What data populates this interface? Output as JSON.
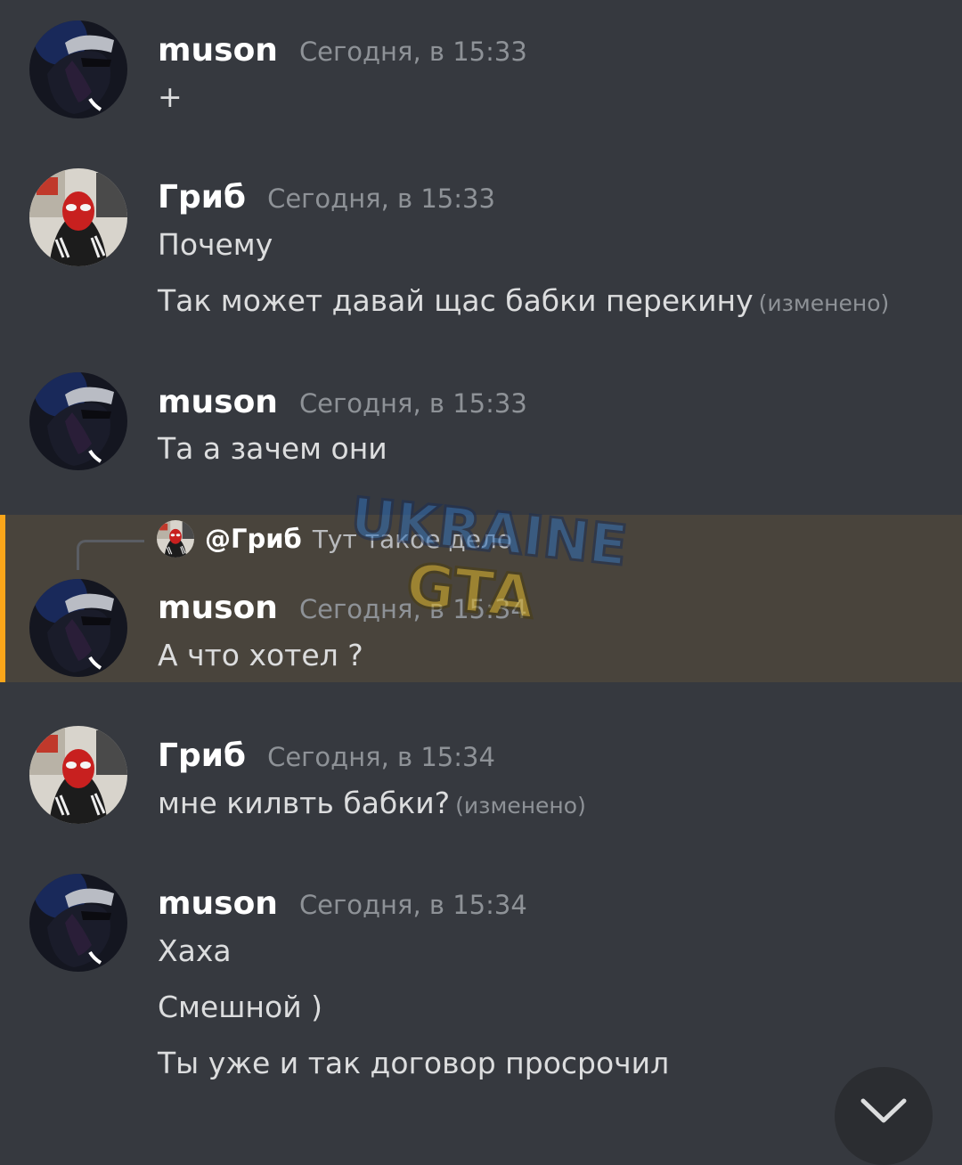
{
  "messages": [
    {
      "author": "muson",
      "time": "Сегодня, в 15:33",
      "lines": [
        {
          "text": "+",
          "edited": ""
        }
      ]
    },
    {
      "author": "Гриб",
      "time": "Сегодня, в 15:33",
      "lines": [
        {
          "text": "Почему",
          "edited": ""
        },
        {
          "text": "Так может давай щас бабки перекину",
          "edited": "(изменено)"
        }
      ]
    },
    {
      "author": "muson",
      "time": "Сегодня, в 15:33",
      "lines": [
        {
          "text": "Та а зачем они",
          "edited": ""
        }
      ]
    },
    {
      "author": "muson",
      "time": "Сегодня, в 15:34",
      "reply": {
        "author": "@Гриб",
        "text": "Тут такое дело"
      },
      "lines": [
        {
          "text": "А что хотел ?",
          "edited": ""
        }
      ]
    },
    {
      "author": "Гриб",
      "time": "Сегодня, в 15:34",
      "lines": [
        {
          "text": "мне килвть бабки?",
          "edited": "(изменено)"
        }
      ]
    },
    {
      "author": "muson",
      "time": "Сегодня, в 15:34",
      "lines": [
        {
          "text": "Хаха",
          "edited": ""
        },
        {
          "text": "Смешной )",
          "edited": ""
        },
        {
          "text": "Ты уже и так договор просрочил",
          "edited": ""
        }
      ]
    }
  ],
  "watermark": {
    "line1": "UKRAINE",
    "line2": "GTA"
  },
  "colors": {
    "background": "#36393f",
    "highlight": "#49443c",
    "highlight_bar": "#faa61a",
    "username": "#ffffff",
    "timestamp": "#8e9297",
    "text": "#dcddde"
  },
  "icons": {
    "scroll_to_bottom": "chevron-down-icon"
  }
}
